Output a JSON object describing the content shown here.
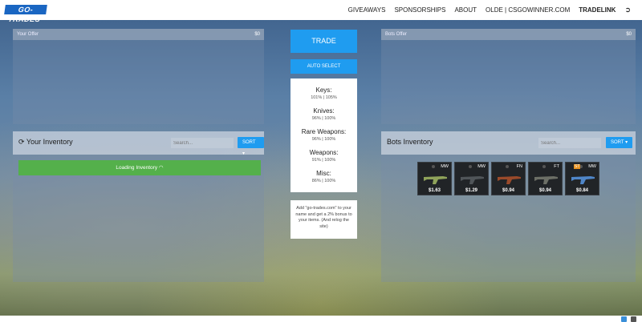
{
  "nav": {
    "logo": "GO-TRADES",
    "links": [
      "GIVEAWAYS",
      "SPONSORSHIPS",
      "ABOUT",
      "OLDE | CSGOWINNER.COM",
      "TRADELINK"
    ],
    "logout_icon": "logout-icon"
  },
  "your_offer": {
    "title": "Your Offer",
    "value": "$0"
  },
  "bots_offer": {
    "title": "Bots Offer",
    "value": "$0"
  },
  "middle": {
    "trade": "TRADE",
    "auto_select": "AUTO SELECT",
    "rates": [
      {
        "label": "Keys:",
        "value": "101% | 105%"
      },
      {
        "label": "Knives:",
        "value": "96% | 100%"
      },
      {
        "label": "Rare Weapons:",
        "value": "96% | 100%"
      },
      {
        "label": "Weapons:",
        "value": "91% | 100%"
      },
      {
        "label": "Misc:",
        "value": "86% | 100%"
      }
    ],
    "bonus": "Add \"go-trades.com\" to your name and get a 2% bonus to your items. (And relog the site)"
  },
  "your_inventory": {
    "title": "Your Inventory",
    "refresh_icon": "refresh-icon",
    "search_placeholder": "Search...",
    "sort": "SORT ▾",
    "loading": "Loading Inventory"
  },
  "bots_inventory": {
    "title": "Bots Inventory",
    "search_placeholder": "Search...",
    "sort": "SORT ▾",
    "items": [
      {
        "wear": "MW",
        "price": "$1.63",
        "stattrak": "",
        "color": "#8fa35a"
      },
      {
        "wear": "MW",
        "price": "$1.29",
        "stattrak": "",
        "color": "#505559"
      },
      {
        "wear": "FN",
        "price": "$0.94",
        "stattrak": "",
        "color": "#9a4a2a"
      },
      {
        "wear": "FT",
        "price": "$0.94",
        "stattrak": "",
        "color": "#6c6f66"
      },
      {
        "wear": "MW",
        "price": "$0.84",
        "stattrak": "ST",
        "color": "#4f86c9"
      }
    ]
  },
  "colors": {
    "accent": "#1f9cf0",
    "loading": "#54b04b"
  }
}
